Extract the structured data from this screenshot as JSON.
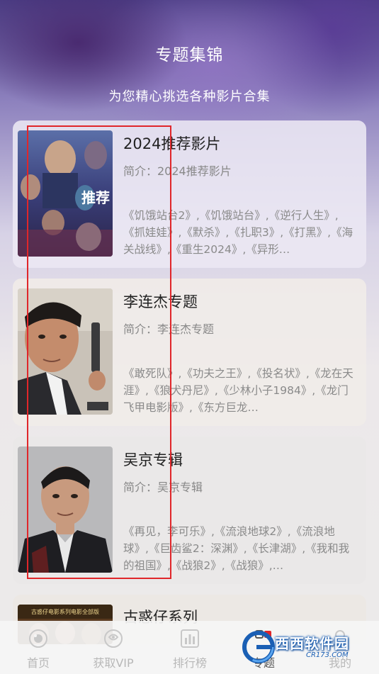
{
  "header": {
    "title": "专题集锦",
    "subtitle": "为您精心挑选各种影片合集"
  },
  "cards": [
    {
      "title": "2024推荐影片",
      "intro": "简介：2024推荐影片",
      "list": "《饥饿站台2》,《饥饿站台》,《逆行人生》,《抓娃娃》,《默杀》,《扎职3》,《打黑》,《海关战线》,《重生2024》,《异形…",
      "poster_text": "推荐"
    },
    {
      "title": "李连杰专题",
      "intro": "简介：李连杰专题",
      "list": "《敢死队》,《功夫之王》,《投名状》,《龙在天涯》,《狼犬丹尼》,《少林小子1984》,《龙门飞甲电影版》,《东方巨龙…"
    },
    {
      "title": "吴京专辑",
      "intro": "简介：吴京专辑",
      "list": "《再见，李可乐》,《流浪地球2》,《流浪地球》,《巨齿鲨2：深渊》,《长津湖》,《我和我的祖国》,《战狼2》,《战狼》,…"
    },
    {
      "title": "古惑仔系列",
      "poster_text": "古惑仔电影系列电影全部版"
    }
  ],
  "tabbar": {
    "items": [
      {
        "label": "首页",
        "icon": "home-icon"
      },
      {
        "label": "获取VIP",
        "icon": "vip-icon"
      },
      {
        "label": "排行榜",
        "icon": "ranking-icon"
      },
      {
        "label": "专题",
        "icon": "topic-icon"
      },
      {
        "label": "我的",
        "icon": "profile-icon"
      }
    ]
  },
  "watermark": {
    "text": "西西软件园",
    "url": "CR173.COM"
  },
  "colors": {
    "highlight_border": "#e0262a",
    "tab_label": "#b8b8b8"
  }
}
